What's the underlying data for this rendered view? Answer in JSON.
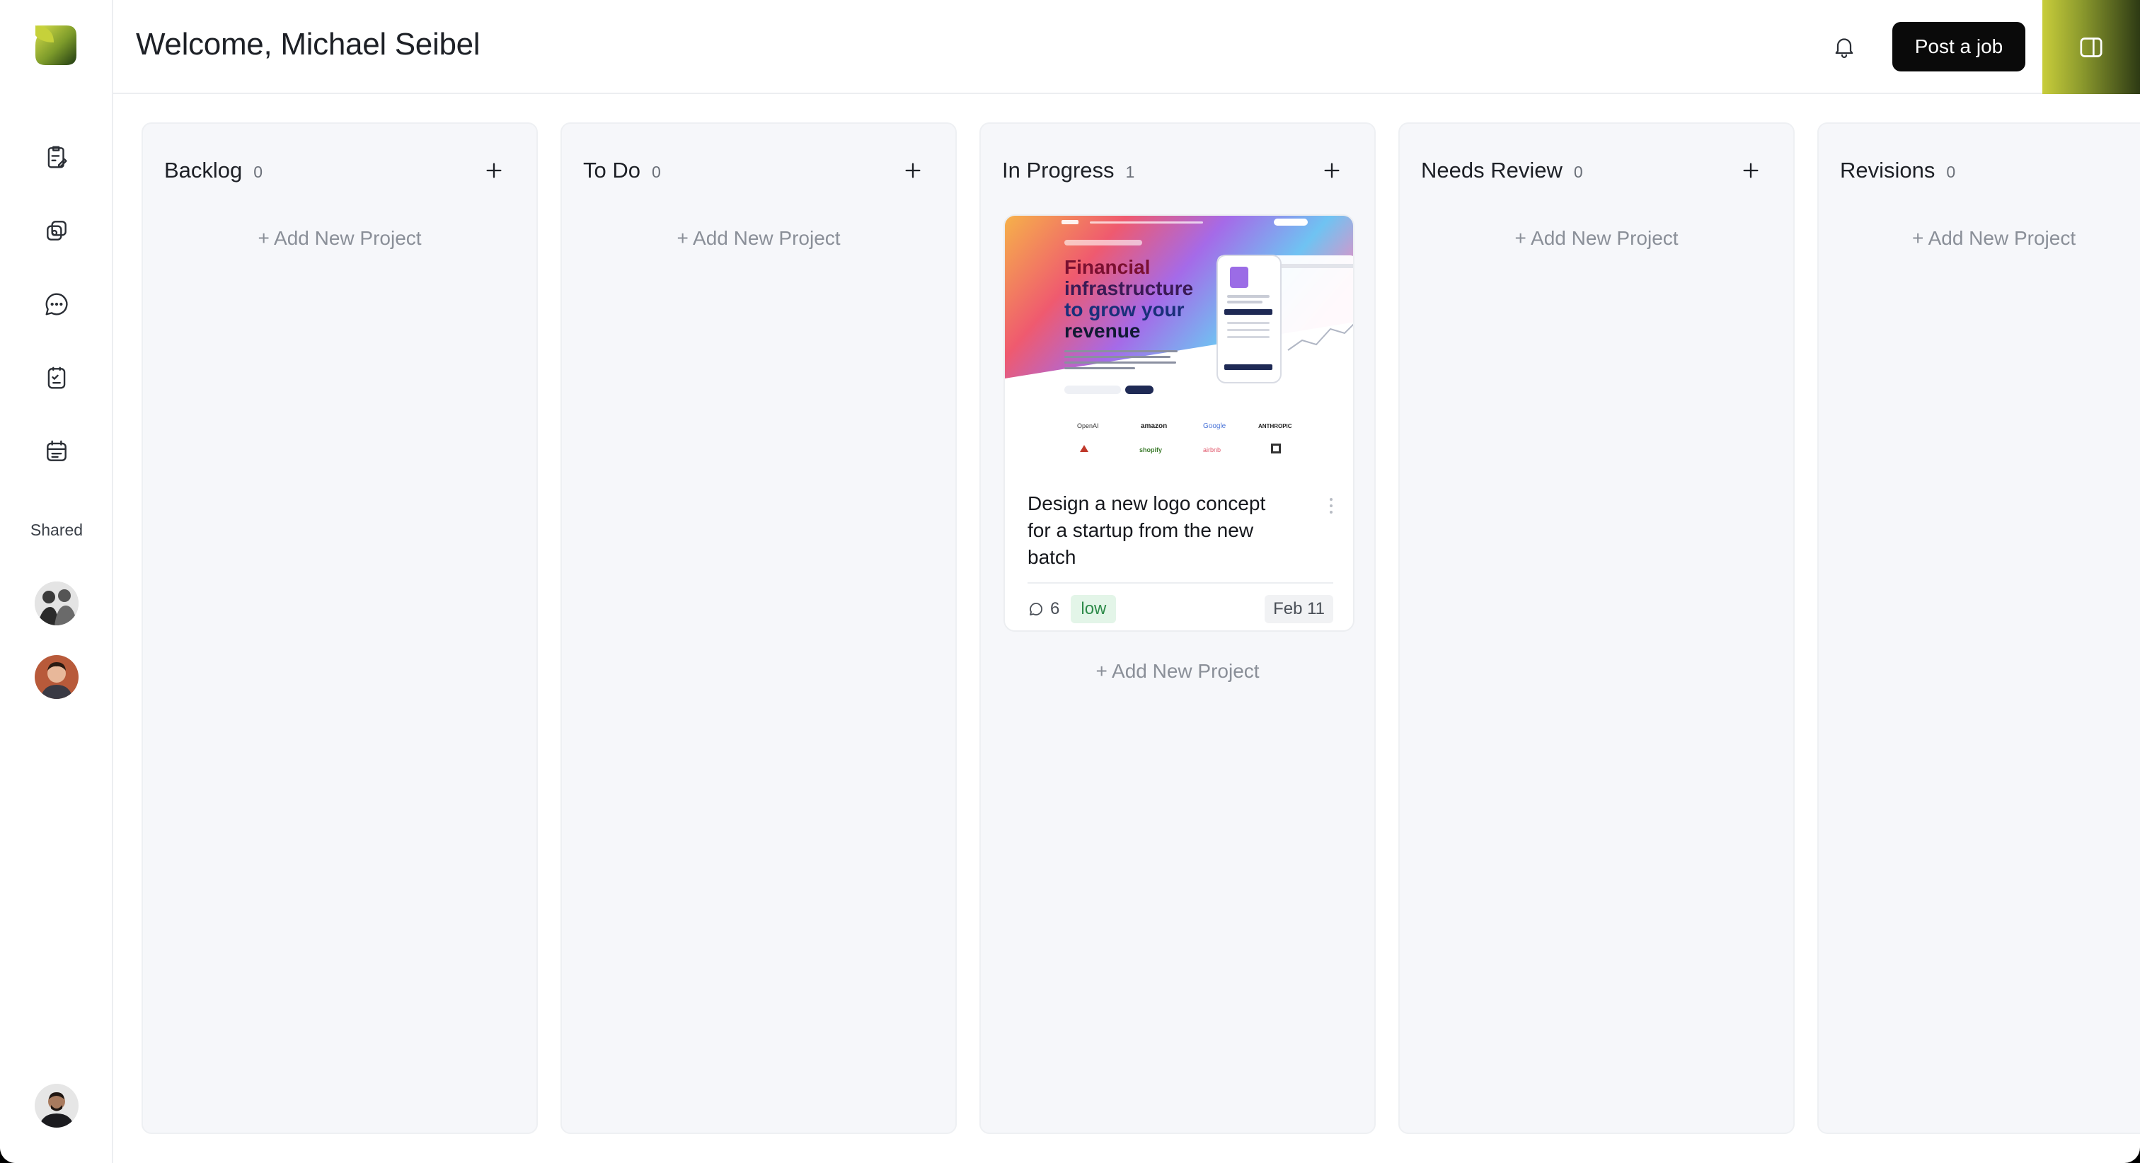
{
  "header": {
    "title": "Welcome, Michael Seibel",
    "post_button": "Post a job"
  },
  "sidebar": {
    "nav": [
      {
        "icon": "clipboard-edit-icon"
      },
      {
        "icon": "layers-icon"
      },
      {
        "icon": "chat-bubble-icon"
      },
      {
        "icon": "task-list-icon"
      },
      {
        "icon": "calendar-card-icon"
      }
    ],
    "shared_label": "Shared"
  },
  "columns": [
    {
      "title": "Backlog",
      "count": "0",
      "add_label": "+ Add New Project"
    },
    {
      "title": "To Do",
      "count": "0",
      "add_label": "+ Add New Project"
    },
    {
      "title": "In Progress",
      "count": "1",
      "add_label": "+ Add New Project"
    },
    {
      "title": "Needs Review",
      "count": "0",
      "add_label": "+ Add New Project"
    },
    {
      "title": "Revisions",
      "count": "0",
      "add_label": "+ Add New Project"
    }
  ],
  "card": {
    "title": "Design a new logo concept for a startup from the new batch",
    "comments": "6",
    "priority": "low",
    "due": "Feb 11",
    "thumbnail": {
      "headline": [
        "Financial",
        "infrastructure",
        "to grow your",
        "revenue"
      ],
      "logos": [
        "OpenAI",
        "amazon",
        "Google",
        "ANTHROPIC",
        "shopify",
        "airbnb"
      ]
    }
  },
  "colors": {
    "accent_dark": "#0a0a0a",
    "priority_low_bg": "#e3f5e8",
    "priority_low_text": "#2e8b4a",
    "column_bg": "#f6f7fa"
  }
}
